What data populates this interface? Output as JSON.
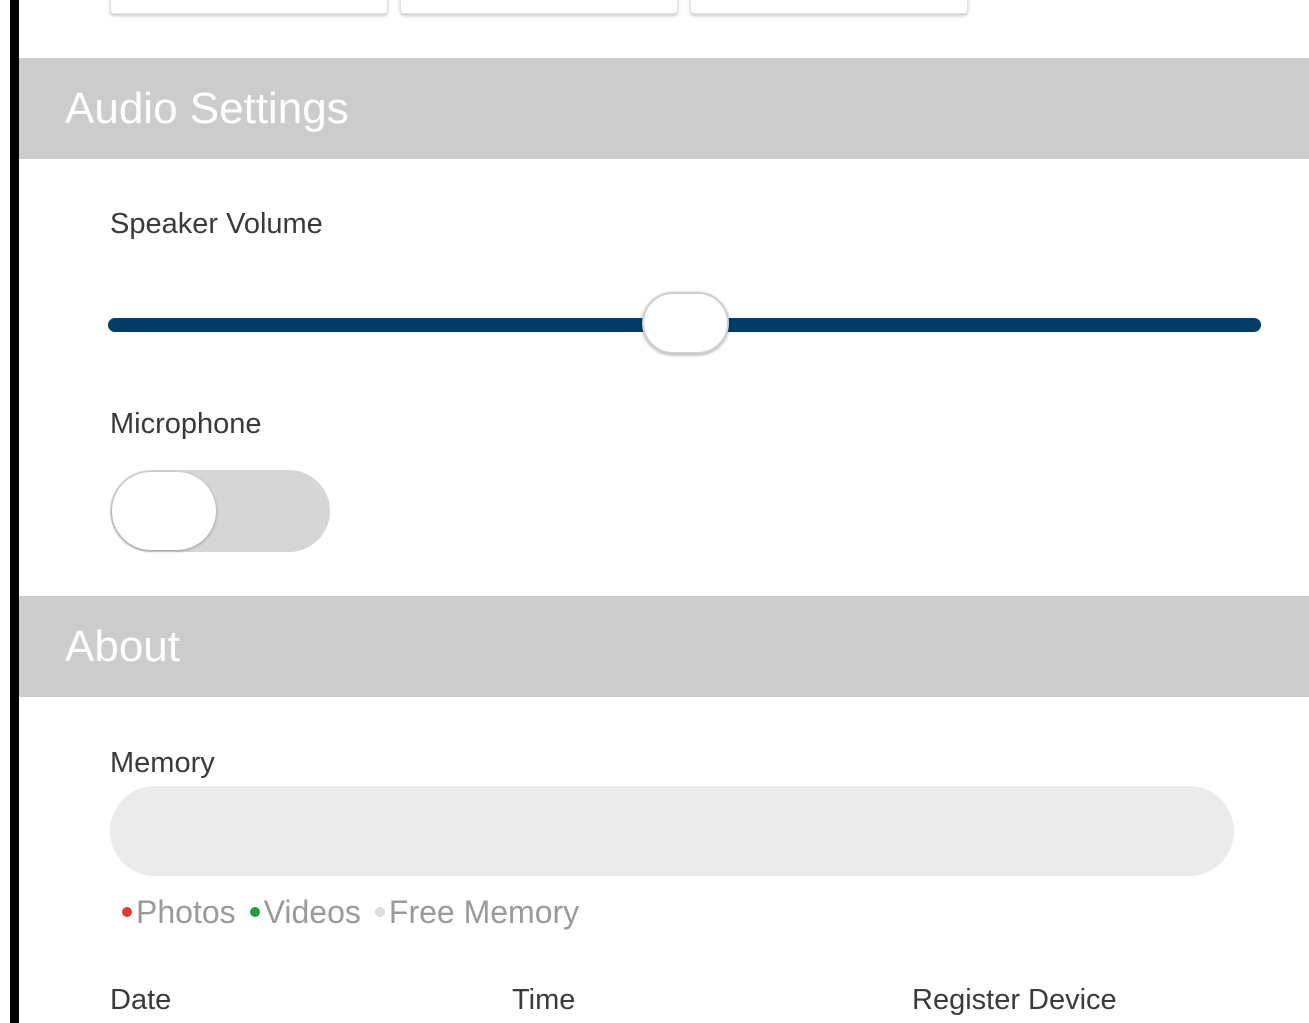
{
  "audio_settings": {
    "title": "Audio Settings",
    "speaker_volume": {
      "label": "Speaker Volume",
      "value_fraction": 0.5
    },
    "microphone": {
      "label": "Microphone",
      "enabled": false
    }
  },
  "about": {
    "title": "About",
    "memory": {
      "label": "Memory",
      "legend": [
        {
          "label": "Photos",
          "color": "#e53935"
        },
        {
          "label": "Videos",
          "color": "#1e9e4a"
        },
        {
          "label": "Free Memory",
          "color": "#dddddd"
        }
      ]
    },
    "table_headers": {
      "date": "Date",
      "time": "Time",
      "register_device": "Register Device"
    }
  },
  "colors": {
    "header_bg": "#cccccc",
    "slider_track": "#003d66",
    "toggle_off": "#d6d6d6"
  }
}
